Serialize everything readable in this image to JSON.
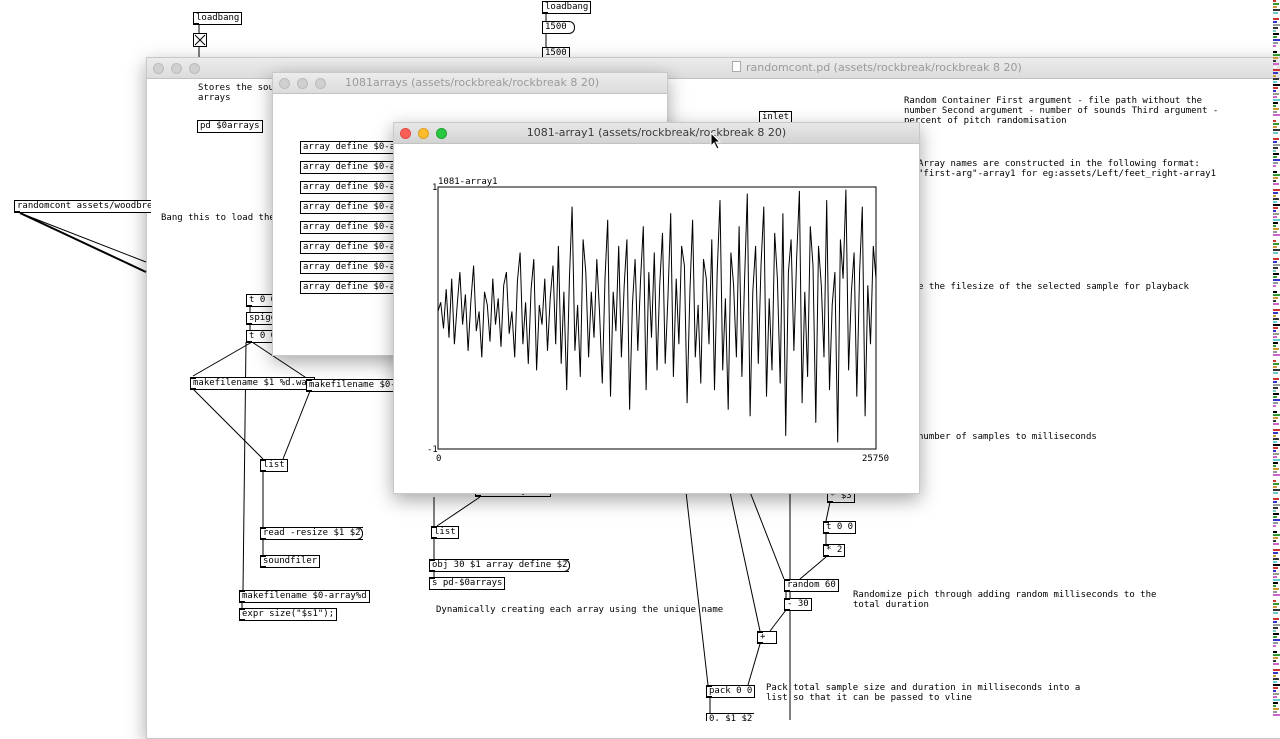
{
  "background_canvas": {
    "loadbang_left": "loadbang",
    "loadbang_right": "loadbang",
    "msg_1500_a": "1500",
    "msg_1500_b": "1500",
    "randomcont_obj": "randomcont assets/woodbre",
    "bang_comment": "Bang this to load the"
  },
  "main_window": {
    "title": "randomcont.pd (assets/rockbreak/rockbreak 8 20)",
    "stores_comment": "Stores the sou\narrays",
    "pd_arrays": "pd $0arrays",
    "inlet": "inlet",
    "desc_comment": "Random Container First argument - file path without the\nnumber Second argument - number of sounds Third argument -\npercent of pitch randomisation",
    "array_names_comment": "Array names are constructed in the following format:\n\"first-arg\"-array1 for eg:assets/Left/feet_right-array1",
    "filesize_comment": "e the filesize of the selected sample for playback",
    "samples_comment": "number of samples to milliseconds",
    "t_0_a": "t 0 0",
    "spigot": "spigo",
    "t_0_b": "t 0 0",
    "makefilename_a": "makefilename $1 %d.wav",
    "makefilename_b": "makefilename $0-a",
    "list_a": "list",
    "read_resize": "read -resize $1 $2",
    "soundfiler": "soundfiler",
    "makefilename_c": "makefilename $0-array%d",
    "expr_size": "expr size(\"$s1\");",
    "list_tosymbol": "list tosymbol",
    "list_b": "list",
    "obj_msg": "obj 30 $1 array define $2",
    "send_arrays": "s pd-$0arrays",
    "dyn_comment": "Dynamically creating each array using the unique name",
    "mul_s3": "* $3",
    "t_0_0": "t 0 0",
    "mul_2": "* 2",
    "random_60": "random 60",
    "minus_30": "- 30",
    "plus": "+",
    "pack_0_0": "pack 0 0",
    "msg_bottom": "0, $1 $2",
    "randomize_comment": "Randomize pich through adding random milliseconds to the\ntotal duration",
    "pack_comment": "Pack total sample size and duration in milliseconds into a\nlist so that it can be passed to vline"
  },
  "arrays_window": {
    "title": "1081arrays (assets/rockbreak/rockbreak 8 20)",
    "items": [
      "array define $0-ar",
      "array define $0-ar",
      "array define $0-ar",
      "array define $0-ar",
      "array define $0-ar",
      "array define $0-ar",
      "array define $0-ar",
      "array define $0-ar"
    ]
  },
  "array_window": {
    "title": "1081-array1 (assets/rockbreak/rockbreak 8 20)"
  },
  "chart_data": {
    "type": "line",
    "title": "1081-array1",
    "xlim": [
      0,
      25750
    ],
    "ylim": [
      -1,
      1
    ],
    "x_min_label": "0",
    "x_max_label": "25750",
    "y_max_label": "1",
    "y_min_label": "-1",
    "values": [
      0.05,
      0.12,
      -0.08,
      0.22,
      -0.15,
      0.3,
      -0.2,
      0.1,
      0.35,
      -0.05,
      0.18,
      -0.25,
      0.12,
      0.4,
      -0.1,
      0.05,
      -0.3,
      0.2,
      0.1,
      -0.18,
      0.3,
      -0.05,
      0.15,
      -0.22,
      0.25,
      0.35,
      -0.12,
      0.05,
      -0.3,
      0.28,
      0.5,
      -0.2,
      0.12,
      -0.35,
      0.22,
      0.45,
      -0.4,
      0.1,
      -0.05,
      0.3,
      -0.25,
      0.15,
      0.4,
      -0.2,
      0.55,
      -0.35,
      0.2,
      -0.55,
      0.3,
      0.85,
      -0.25,
      0.1,
      -0.45,
      0.6,
      0.35,
      -0.3,
      0.2,
      -0.15,
      0.45,
      0.05,
      -0.5,
      0.3,
      0.75,
      -0.6,
      0.2,
      -0.1,
      0.55,
      -0.3,
      0.25,
      0.6,
      -0.7,
      0.1,
      0.45,
      -0.25,
      0.3,
      0.7,
      -0.55,
      0.35,
      -0.15,
      0.5,
      -0.4,
      0.25,
      0.65,
      -0.35,
      0.15,
      0.8,
      -0.45,
      0.3,
      -0.2,
      0.55,
      0.4,
      -0.65,
      0.2,
      0.75,
      -0.3,
      0.1,
      -0.5,
      0.45,
      0.3,
      -0.2,
      0.6,
      -0.55,
      0.35,
      0.9,
      -0.4,
      0.15,
      -0.7,
      0.5,
      0.25,
      -0.3,
      0.7,
      -0.45,
      0.3,
      0.95,
      -0.75,
      0.2,
      0.55,
      -0.35,
      0.4,
      0.85,
      -0.6,
      0.15,
      -0.4,
      0.65,
      0.3,
      -0.5,
      0.8,
      -0.9,
      0.35,
      0.6,
      -0.25,
      0.45,
      0.97,
      -0.65,
      0.2,
      -0.45,
      0.7,
      0.4,
      -0.8,
      0.55,
      0.25,
      -0.3,
      0.9,
      -0.55,
      0.1,
      0.35,
      -0.95,
      0.6,
      0.3,
      0.98,
      -0.4,
      0.2,
      0.5,
      -0.6,
      0.35,
      0.85,
      -0.75,
      0.25,
      -0.2,
      0.55,
      0.3
    ]
  }
}
